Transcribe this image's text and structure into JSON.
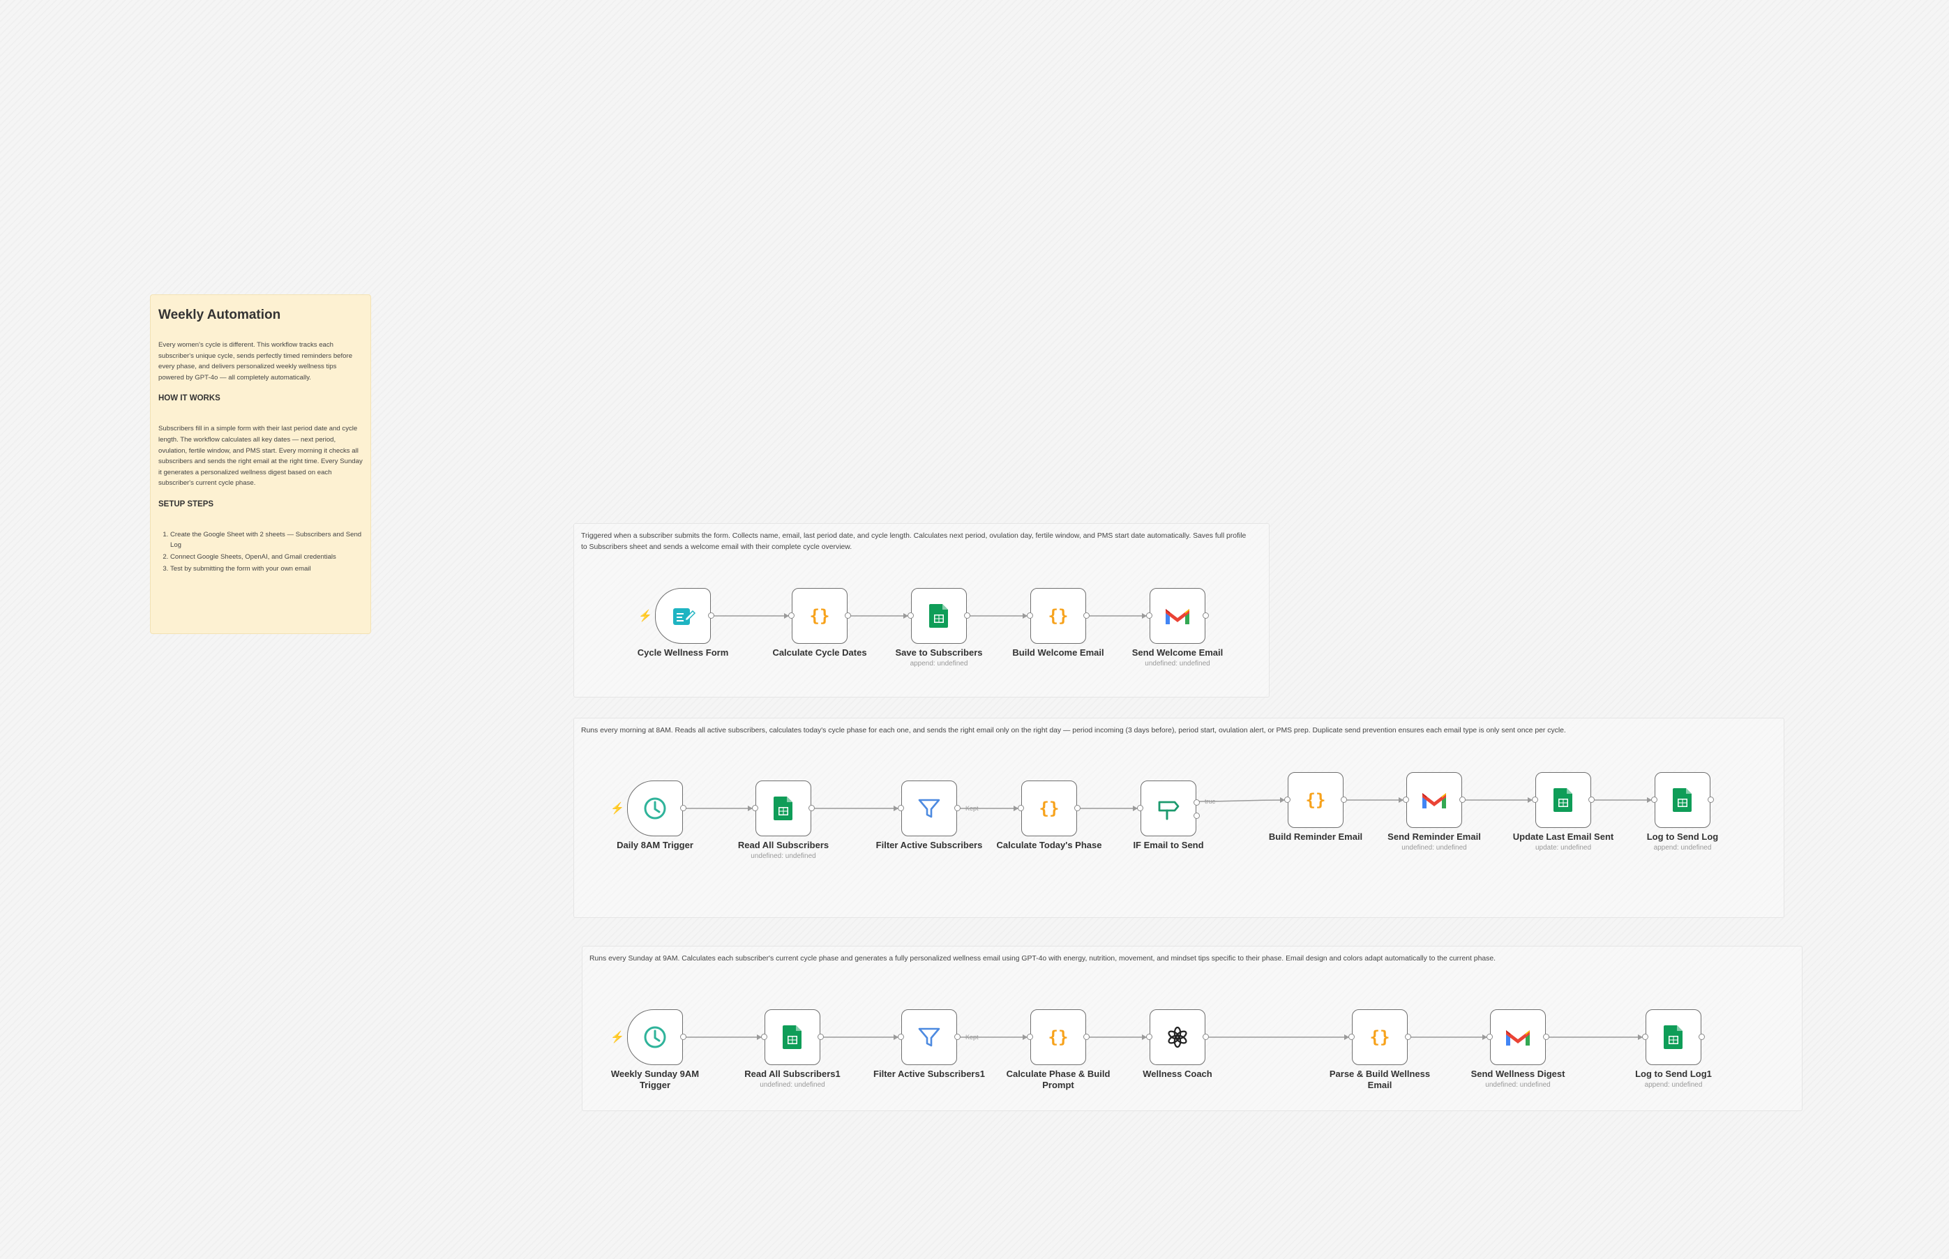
{
  "sticky": {
    "title": "Weekly Automation",
    "intro": "Every women's cycle is different. This workflow tracks each subscriber's unique cycle, sends perfectly timed reminders before every phase, and delivers personalized weekly wellness tips powered by GPT-4o — all completely automatically.",
    "how_heading": "HOW IT WORKS",
    "how_text": "Subscribers fill in a simple form with their last period date and cycle length. The workflow calculates all key dates — next period, ovulation, fertile window, and PMS start. Every morning it checks all subscribers and sends the right email at the right time. Every Sunday it generates a personalized wellness digest based on each subscriber's current cycle phase.",
    "setup_heading": "SETUP STEPS",
    "steps": [
      "Create the Google Sheet with 2 sheets — Subscribers and Send Log",
      "Connect Google Sheets, OpenAI, and Gmail credentials",
      "Test by submitting the form with your own email"
    ]
  },
  "groups": [
    {
      "description": "Triggered when a subscriber submits the form. Collects name, email, last period date, and cycle length. Calculates next period, ovulation day, fertile window, and PMS start date automatically. Saves full profile to Subscribers sheet and sends a welcome email with their complete cycle overview."
    },
    {
      "description": "Runs every morning at 8AM. Reads all active subscribers, calculates today's cycle phase for each one, and sends the right email only on the right day — period incoming (3 days before), period start, ovulation alert, or PMS prep. Duplicate send prevention ensures each email type is only sent once per cycle."
    },
    {
      "description": "Runs every Sunday at 9AM. Calculates each subscriber's current cycle phase and generates a fully personalized wellness email using GPT-4o with energy, nutrition, movement, and mindset tips specific to their phase. Email design and colors adapt automatically to the current phase."
    }
  ],
  "nodes": [
    {
      "id": "form",
      "label": "Cycle Wellness Form",
      "sub": "",
      "icon": "form-icon",
      "trigger": true,
      "group": 0,
      "color": "#1fb4c2"
    },
    {
      "id": "calcDates",
      "label": "Calculate Cycle Dates",
      "sub": "",
      "icon": "code-icon",
      "group": 0,
      "color": "#f7a21b"
    },
    {
      "id": "saveSubs",
      "label": "Save to Subscribers",
      "sub": "append: undefined",
      "icon": "sheets-icon",
      "group": 0,
      "color": "#0f9d58"
    },
    {
      "id": "buildWelcome",
      "label": "Build Welcome Email",
      "sub": "",
      "icon": "code-icon",
      "group": 0,
      "color": "#f7a21b"
    },
    {
      "id": "sendWelcome",
      "label": "Send Welcome Email",
      "sub": "undefined: undefined",
      "icon": "gmail-icon",
      "group": 0
    },
    {
      "id": "daily",
      "label": "Daily 8AM Trigger",
      "sub": "",
      "icon": "clock-icon",
      "trigger": true,
      "group": 1,
      "color": "#2fb39a"
    },
    {
      "id": "readAll",
      "label": "Read All Subscribers",
      "sub": "undefined: undefined",
      "icon": "sheets-icon",
      "group": 1,
      "color": "#0f9d58"
    },
    {
      "id": "filterActive",
      "label": "Filter Active Subscribers",
      "sub": "",
      "icon": "filter-icon",
      "group": 1,
      "color": "#4d8ae0"
    },
    {
      "id": "calcPhase",
      "label": "Calculate Today's Phase",
      "sub": "",
      "icon": "code-icon",
      "group": 1,
      "color": "#f7a21b"
    },
    {
      "id": "ifSend",
      "label": "IF Email to Send",
      "sub": "",
      "icon": "if-icon",
      "group": 1,
      "color": "#1c9a6e",
      "outs": 2
    },
    {
      "id": "buildReminder",
      "label": "Build Reminder Email",
      "sub": "",
      "icon": "code-icon",
      "group": 1,
      "color": "#f7a21b"
    },
    {
      "id": "sendReminder",
      "label": "Send Reminder Email",
      "sub": "undefined: undefined",
      "icon": "gmail-icon",
      "group": 1
    },
    {
      "id": "updateLast",
      "label": "Update Last Email Sent",
      "sub": "update: undefined",
      "icon": "sheets-icon",
      "group": 1,
      "color": "#0f9d58"
    },
    {
      "id": "logSend",
      "label": "Log to Send Log",
      "sub": "append: undefined",
      "icon": "sheets-icon",
      "group": 1,
      "color": "#0f9d58"
    },
    {
      "id": "weekly",
      "label": "Weekly Sunday 9AM Trigger",
      "sub": "",
      "icon": "clock-icon",
      "trigger": true,
      "group": 2,
      "color": "#2fb39a"
    },
    {
      "id": "readAll1",
      "label": "Read All Subscribers1",
      "sub": "undefined: undefined",
      "icon": "sheets-icon",
      "group": 2,
      "color": "#0f9d58"
    },
    {
      "id": "filterActive1",
      "label": "Filter Active Subscribers1",
      "sub": "",
      "icon": "filter-icon",
      "group": 2,
      "color": "#4d8ae0"
    },
    {
      "id": "calcPrompt",
      "label": "Calculate Phase & Build Prompt",
      "sub": "",
      "icon": "code-icon",
      "group": 2,
      "color": "#f7a21b"
    },
    {
      "id": "coach",
      "label": "Wellness Coach",
      "sub": "",
      "icon": "openai-icon",
      "group": 2,
      "color": "#222222"
    },
    {
      "id": "parseBuild",
      "label": "Parse & Build Wellness Email",
      "sub": "",
      "icon": "code-icon",
      "group": 2,
      "color": "#f7a21b"
    },
    {
      "id": "sendDigest",
      "label": "Send Wellness Digest",
      "sub": "undefined: undefined",
      "icon": "gmail-icon",
      "group": 2
    },
    {
      "id": "logSend1",
      "label": "Log to Send Log1",
      "sub": "append: undefined",
      "icon": "sheets-icon",
      "group": 2,
      "color": "#0f9d58"
    }
  ],
  "connections": [
    {
      "from": "form",
      "to": "calcDates"
    },
    {
      "from": "calcDates",
      "to": "saveSubs"
    },
    {
      "from": "saveSubs",
      "to": "buildWelcome"
    },
    {
      "from": "buildWelcome",
      "to": "sendWelcome"
    },
    {
      "from": "daily",
      "to": "readAll"
    },
    {
      "from": "readAll",
      "to": "filterActive"
    },
    {
      "from": "filterActive",
      "to": "calcPhase",
      "label": "Kept"
    },
    {
      "from": "calcPhase",
      "to": "ifSend"
    },
    {
      "from": "ifSend",
      "to": "buildReminder",
      "label": "true",
      "port": 1
    },
    {
      "from": "buildReminder",
      "to": "sendReminder"
    },
    {
      "from": "sendReminder",
      "to": "updateLast"
    },
    {
      "from": "updateLast",
      "to": "logSend"
    },
    {
      "from": "weekly",
      "to": "readAll1"
    },
    {
      "from": "readAll1",
      "to": "filterActive1"
    },
    {
      "from": "filterActive1",
      "to": "calcPrompt",
      "label": "Kept"
    },
    {
      "from": "calcPrompt",
      "to": "coach"
    },
    {
      "from": "coach",
      "to": "parseBuild"
    },
    {
      "from": "parseBuild",
      "to": "sendDigest"
    },
    {
      "from": "sendDigest",
      "to": "logSend1"
    }
  ]
}
